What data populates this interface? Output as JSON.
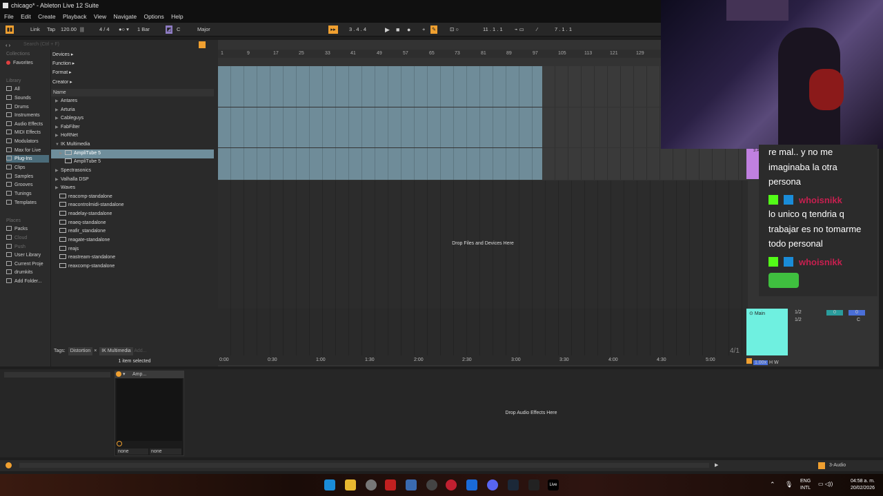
{
  "window": {
    "title": "chicago* - Ableton Live 12 Suite"
  },
  "menu": [
    "File",
    "Edit",
    "Create",
    "Playback",
    "View",
    "Navigate",
    "Options",
    "Help"
  ],
  "transport": {
    "link": "Link",
    "tap": "Tap",
    "tempo": "120.00",
    "meter": "4 / 4",
    "quantize": "1 Bar",
    "key": "C",
    "scale": "Major",
    "position": "3 .  4 .  4",
    "loop_start": "11 .  1 .  1",
    "loop_length": "7 .  1 .  1"
  },
  "browser": {
    "search_placeholder": "Search (Ctrl + F)",
    "collections_label": "Collections",
    "favorites": "Favorites",
    "library_label": "Library",
    "library": [
      "All",
      "Sounds",
      "Drums",
      "Instruments",
      "Audio Effects",
      "MIDI Effects",
      "Modulators",
      "Max for Live",
      "Plug-Ins",
      "Clips",
      "Samples",
      "Grooves",
      "Tunings",
      "Templates"
    ],
    "places_label": "Places",
    "places": [
      "Packs",
      "Cloud",
      "Push",
      "User Library",
      "Current Proje",
      "drumkits",
      "Add Folder..."
    ],
    "filters": [
      "Devices ▸",
      "Function ▸",
      "Format ▸",
      "Creator ▸"
    ],
    "name_header": "Name",
    "items": [
      {
        "label": "Antares",
        "arrow": "▶",
        "type": "folder"
      },
      {
        "label": "Arturia",
        "arrow": "▶",
        "type": "folder"
      },
      {
        "label": "Cableguys",
        "arrow": "▶",
        "type": "folder"
      },
      {
        "label": "FabFilter",
        "arrow": "▶",
        "type": "folder"
      },
      {
        "label": "HoRNet",
        "arrow": "▶",
        "type": "folder"
      },
      {
        "label": "IK Multimedia",
        "arrow": "▼",
        "type": "folder"
      },
      {
        "label": "AmpliTube 5",
        "arrow": "▶",
        "type": "plugin",
        "selected": true
      },
      {
        "label": "AmpliTube 5",
        "arrow": "",
        "type": "plugin"
      },
      {
        "label": "Spectrasonics",
        "arrow": "▶",
        "type": "folder"
      },
      {
        "label": "Valhalla DSP",
        "arrow": "▶",
        "type": "folder"
      },
      {
        "label": "Waves",
        "arrow": "▶",
        "type": "folder"
      },
      {
        "label": "reacomp-standalone",
        "arrow": "",
        "type": "plugin"
      },
      {
        "label": "reacontrolmidi-standalone",
        "arrow": "",
        "type": "plugin"
      },
      {
        "label": "readelay-standalone",
        "arrow": "",
        "type": "plugin"
      },
      {
        "label": "reaeq-standalone",
        "arrow": "",
        "type": "plugin"
      },
      {
        "label": "reafir_standalone",
        "arrow": "",
        "type": "plugin"
      },
      {
        "label": "reagate-standalone",
        "arrow": "",
        "type": "plugin"
      },
      {
        "label": "reajs",
        "arrow": "",
        "type": "plugin"
      },
      {
        "label": "reastream-standalone",
        "arrow": "",
        "type": "plugin"
      },
      {
        "label": "reaxcomp-standalone",
        "arrow": "",
        "type": "plugin"
      }
    ],
    "tags_label": "Tags:",
    "tags": [
      "Distortion",
      "IK Multimedia"
    ],
    "tags_add": "Add...",
    "selection_info": "1 item selected"
  },
  "arrangement": {
    "bar_ticks": [
      "1",
      "9",
      "17",
      "25",
      "33",
      "41",
      "49",
      "57",
      "65",
      "73",
      "81",
      "89",
      "97",
      "105",
      "113",
      "121",
      "129"
    ],
    "time_ticks": [
      "0:00",
      "0:30",
      "1:00",
      "1:30",
      "2:00",
      "2:30",
      "3:00",
      "3:30",
      "4:00",
      "4:30",
      "5:00"
    ],
    "drop_files_label": "Drop Files and Devices Here",
    "time_signature": "4/1",
    "main_track": "Main",
    "io_a": "1/2",
    "io_b": "1/2",
    "zoom": "1.00x",
    "h": "H",
    "w": "W",
    "track3_label": "3 Audi",
    "sends": [
      "0",
      "0"
    ],
    "pan": "C"
  },
  "chat": {
    "lines": [
      "re mal.. y no me",
      "imaginaba la otra",
      "persona"
    ],
    "user": "whoisnikk",
    "msg2_lines": [
      "lo unico q tendria q",
      "trabajar es no tomarme",
      "todo personal"
    ],
    "user2": "whoisnikk"
  },
  "device": {
    "name": "Amp...",
    "in_select": "none",
    "out_select": "none",
    "drop_label": "Drop Audio Effects Here"
  },
  "status": {
    "track": "3-Audio"
  },
  "taskbar": {
    "lang": "ENG",
    "lang2": "INTL",
    "time": "04:58 a. m.",
    "date": "20/02/2026"
  }
}
